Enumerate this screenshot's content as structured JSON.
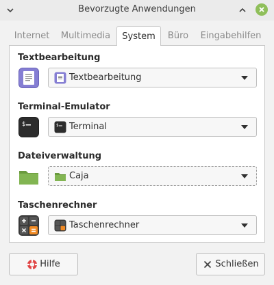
{
  "window": {
    "title": "Bevorzugte Anwendungen",
    "menu_icon": "chevron-down-icon",
    "minimize_icon": "chevron-up-icon",
    "close_icon": "close-icon",
    "close_color": "#8fbf5a"
  },
  "tabs": [
    {
      "label": "Internet",
      "active": false
    },
    {
      "label": "Multimedia",
      "active": false
    },
    {
      "label": "System",
      "active": true
    },
    {
      "label": "Büro",
      "active": false
    },
    {
      "label": "Eingabehilfen",
      "active": false
    }
  ],
  "sections": [
    {
      "title": "Textbearbeitung",
      "icon": "text-editor-icon",
      "selected": "Textbearbeitung"
    },
    {
      "title": "Terminal-Emulator",
      "icon": "terminal-icon",
      "selected": "Terminal"
    },
    {
      "title": "Dateiverwaltung",
      "icon": "folder-icon",
      "selected": "Caja"
    },
    {
      "title": "Taschenrechner",
      "icon": "calculator-icon",
      "selected": "Taschenrechner"
    }
  ],
  "buttons": {
    "help": {
      "label": "Hilfe",
      "icon": "lifebuoy-icon"
    },
    "close": {
      "label": "Schließen",
      "icon": "close-x-icon"
    }
  },
  "colors": {
    "accent_green": "#8fbf5a",
    "text_editor_purple": "#7b74c9",
    "folder_green": "#7fb24e",
    "calculator_orange": "#f08a24"
  }
}
